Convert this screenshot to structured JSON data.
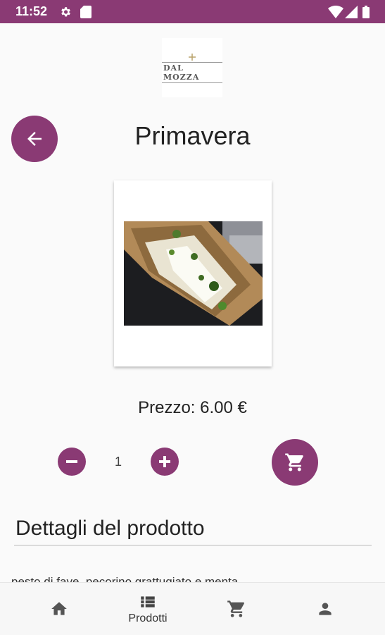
{
  "status_bar": {
    "time": "11:52",
    "icons": [
      "gear-icon",
      "sd-card-icon",
      "wifi-icon",
      "signal-icon",
      "battery-icon"
    ],
    "color": "#8a3a74"
  },
  "logo": {
    "text": "DAL MOZZA"
  },
  "header": {
    "back_icon": "arrow-left-icon",
    "title": "Primavera"
  },
  "product": {
    "image_alt": "Primavera",
    "price_label": "Prezzo: 6.00 €",
    "quantity": "1"
  },
  "details": {
    "heading": "Dettagli del prodotto",
    "description": "pesto di fave, pecorino grattugiato e menta"
  },
  "bottom_nav": {
    "items": [
      {
        "icon": "home-icon",
        "label": ""
      },
      {
        "icon": "list-icon",
        "label": "Prodotti"
      },
      {
        "icon": "cart-icon",
        "label": ""
      },
      {
        "icon": "person-icon",
        "label": ""
      }
    ]
  },
  "colors": {
    "accent": "#8a3a74",
    "background": "#fafafa"
  }
}
